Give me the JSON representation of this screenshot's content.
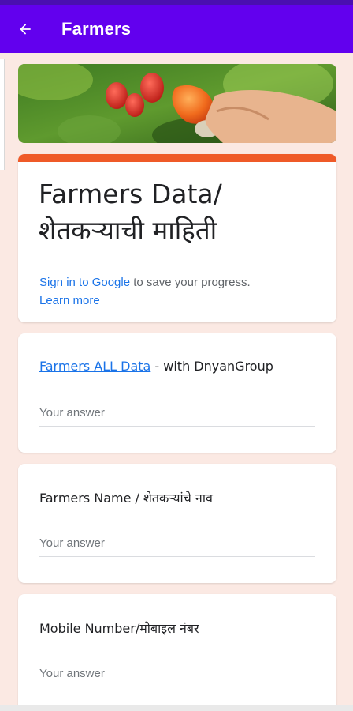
{
  "app_bar": {
    "title": "Farmers",
    "back_icon": "arrow-left-icon",
    "color": "#6200ee"
  },
  "form": {
    "accent_color": "#ef5a28",
    "title_line1": "Farmers Data/",
    "title_line2": "शेतकऱ्याची माहिती",
    "signin_link": "Sign in to Google",
    "signin_text": " to save your progress.",
    "learn_more": "Learn more"
  },
  "questions": [
    {
      "link": "Farmers ALL Data",
      "label_suffix": " - with DnyanGroup",
      "placeholder": "Your answer"
    },
    {
      "label": "Farmers Name / शेतकऱ्यांचे नाव",
      "placeholder": "Your answer"
    },
    {
      "label": "Mobile Number/मोबाइल नंबर",
      "placeholder": "Your answer"
    }
  ]
}
